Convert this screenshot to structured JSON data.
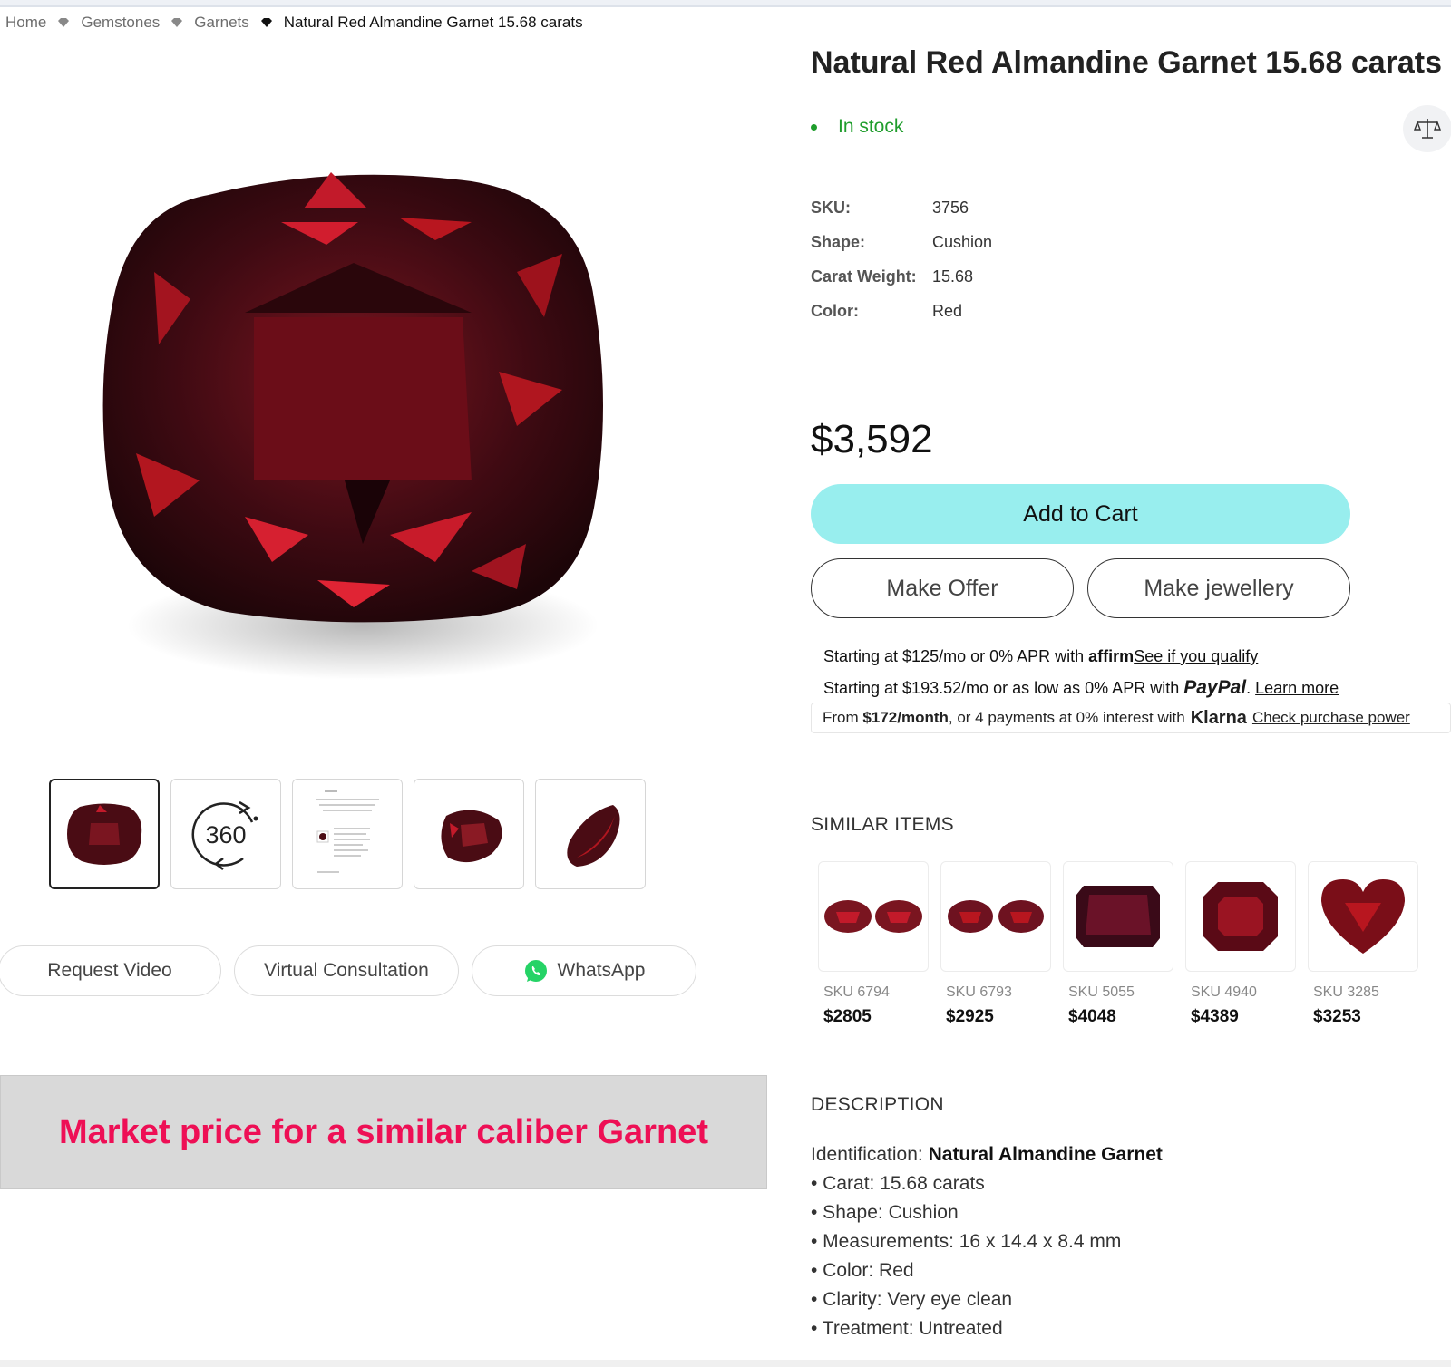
{
  "breadcrumb": {
    "items": [
      "Home",
      "Gemstones",
      "Garnets"
    ],
    "current": "Natural Red Almandine Garnet 15.68 carats"
  },
  "product": {
    "title": "Natural Red Almandine Garnet 15.68 carats",
    "stock": "In stock",
    "specs": [
      {
        "label": "SKU:",
        "value": "3756"
      },
      {
        "label": "Shape:",
        "value": "Cushion"
      },
      {
        "label": "Carat Weight:",
        "value": "15.68"
      },
      {
        "label": "Color:",
        "value": "Red"
      }
    ],
    "price": "$3,592"
  },
  "actions": {
    "add_to_cart": "Add to Cart",
    "make_offer": "Make Offer",
    "make_jewellery": "Make jewellery"
  },
  "financing": {
    "affirm": {
      "prefix": "Starting at $125/mo or 0% APR with",
      "brand": "affirm",
      "link": "See if you qualify"
    },
    "paypal": {
      "prefix": "Starting at $193.52/mo or as low as 0% APR with",
      "brand": "PayPal",
      "link": "Learn more"
    },
    "klarna": {
      "from": "From",
      "amount": "$172/month",
      "middle": ", or 4 payments at 0% interest with",
      "brand": "Klarna",
      "link": "Check purchase power"
    }
  },
  "gallery": {
    "thumb_360_label": "360"
  },
  "contact": {
    "request_video": "Request Video",
    "virtual_consultation": "Virtual Consultation",
    "whatsapp": "WhatsApp"
  },
  "banner": {
    "text": "Market price for a similar caliber Garnet"
  },
  "similar": {
    "heading": "SIMILAR ITEMS",
    "items": [
      {
        "sku": "SKU 6794",
        "price": "$2805"
      },
      {
        "sku": "SKU 6793",
        "price": "$2925"
      },
      {
        "sku": "SKU 5055",
        "price": "$4048"
      },
      {
        "sku": "SKU 4940",
        "price": "$4389"
      },
      {
        "sku": "SKU 3285",
        "price": "$3253"
      }
    ]
  },
  "description": {
    "heading": "DESCRIPTION",
    "identification_label": "Identification:",
    "identification_value": "Natural Almandine Garnet",
    "bullets": [
      "• Carat: 15.68 carats",
      "• Shape: Cushion",
      "• Measurements: 16 x 14.4 x 8.4 mm",
      "• Color: Red",
      "• Clarity: Very eye clean",
      "• Treatment: Untreated"
    ]
  },
  "colors": {
    "accent_cart": "#98eeee",
    "in_stock": "#1f9d2c",
    "banner_text": "#ee0f55",
    "gem": "#5a0f18"
  }
}
